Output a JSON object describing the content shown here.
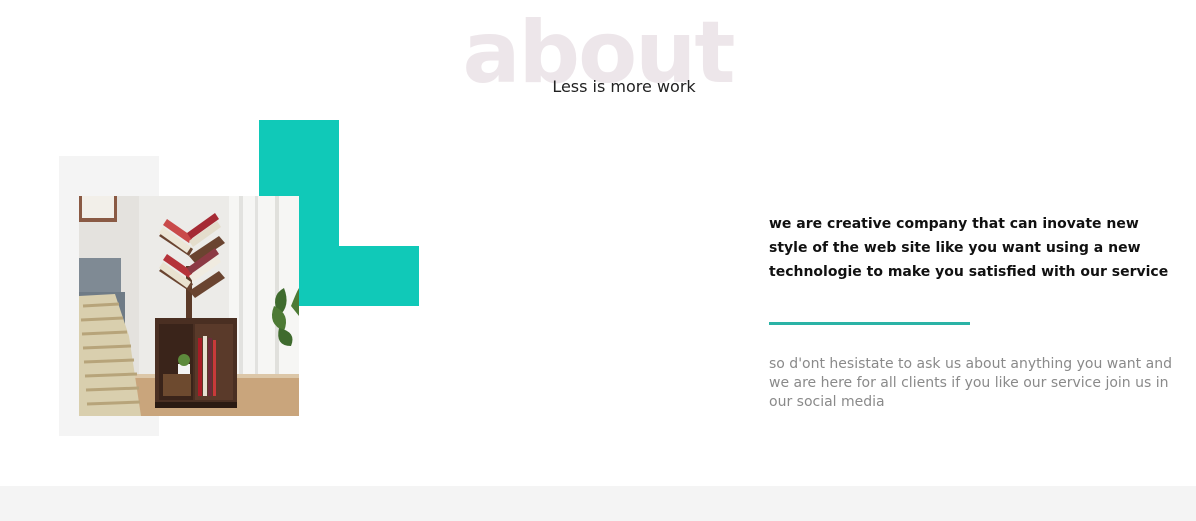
{
  "about": {
    "background_title": "about",
    "subtitle": "Less is more work",
    "headline": "we are creative company that can inovate new style of the web site like you want using a new technologie to make you satisfied with our service",
    "body": "so d'ont hesistate to ask us about anything you want and we are here for all clients if you like our service join us in our social media"
  },
  "colors": {
    "accent": "#10c9b8",
    "divider": "#2ab3a6",
    "background_title": "#ede6ea",
    "panel": "#f4f4f4",
    "headline": "#111111",
    "body": "#8a8a8a"
  }
}
